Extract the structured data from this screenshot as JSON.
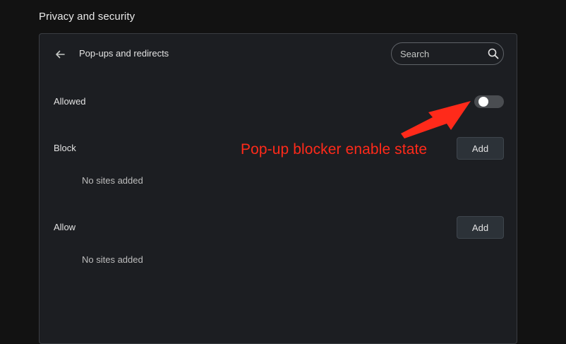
{
  "section": {
    "heading": "Privacy and security"
  },
  "card": {
    "title": "Pop-ups and redirects",
    "back_icon": "arrow-back-icon",
    "search": {
      "placeholder": "Search",
      "value": "",
      "icon": "search-icon"
    },
    "allowed": {
      "label": "Allowed",
      "toggle_on": false
    },
    "block": {
      "label": "Block",
      "add_label": "Add",
      "empty_text": "No sites added"
    },
    "allow": {
      "label": "Allow",
      "add_label": "Add",
      "empty_text": "No sites added"
    }
  },
  "annotation": {
    "text": "Pop-up blocker enable state",
    "color": "#ff2a1a"
  },
  "colors": {
    "background": "#121212",
    "card": "#1c1e22",
    "button": "#2c3238"
  }
}
